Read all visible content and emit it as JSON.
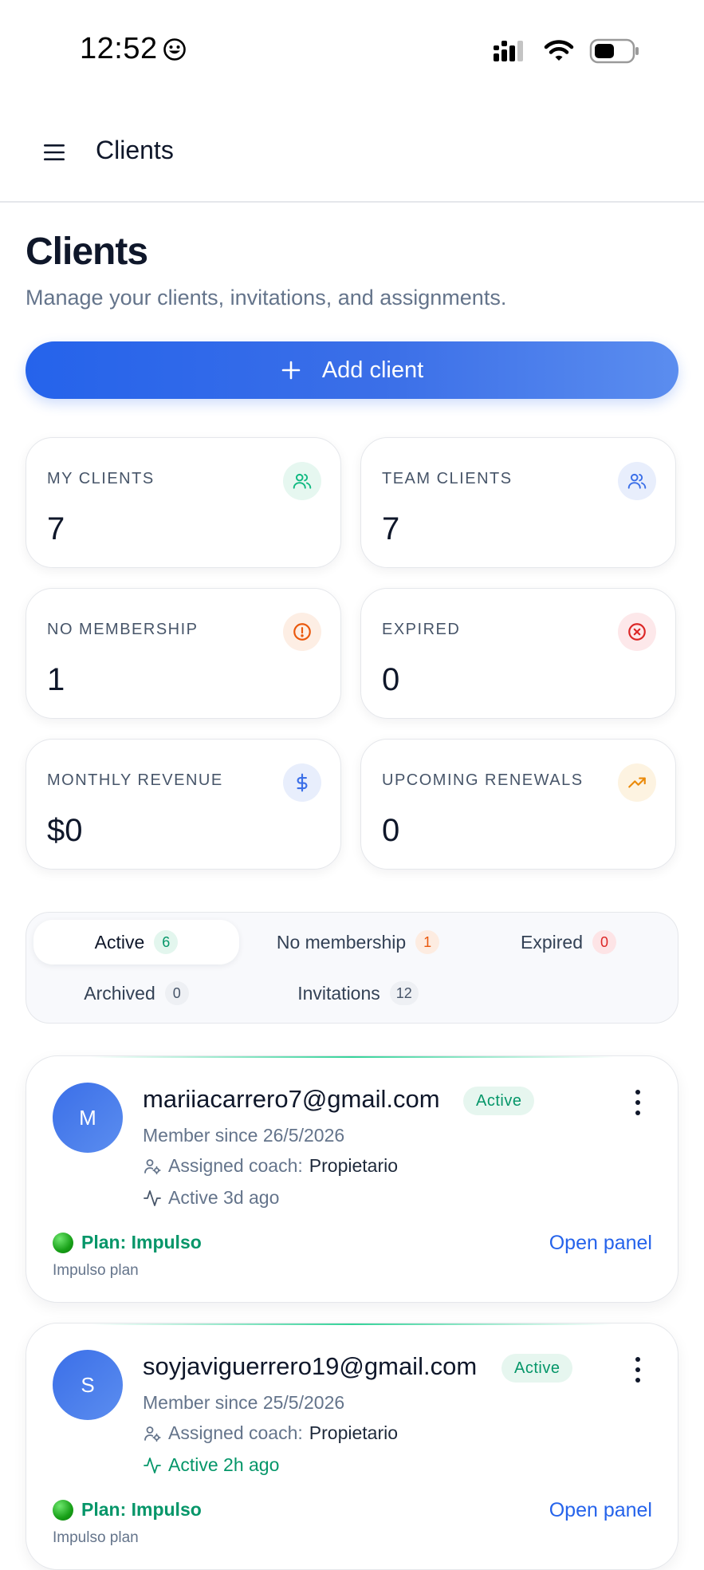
{
  "status_bar": {
    "time": "12:52"
  },
  "topbar": {
    "title": "Clients"
  },
  "page": {
    "title": "Clients",
    "subtitle": "Manage your clients, invitations, and assignments.",
    "add_button": "Add client"
  },
  "stats": [
    {
      "label": "MY CLIENTS",
      "value": "7",
      "icon": "users-icon",
      "color": "#10b981"
    },
    {
      "label": "TEAM CLIENTS",
      "value": "7",
      "icon": "users-icon",
      "color": "#3b6fe8"
    },
    {
      "label": "NO MEMBERSHIP",
      "value": "1",
      "icon": "alert-circle-icon",
      "color": "#ea580c"
    },
    {
      "label": "EXPIRED",
      "value": "0",
      "icon": "x-circle-icon",
      "color": "#dc2626"
    },
    {
      "label": "MONTHLY REVENUE",
      "value": "$0",
      "icon": "dollar-icon",
      "color": "#3b6fe8"
    },
    {
      "label": "UPCOMING RENEWALS",
      "value": "0",
      "icon": "trending-up-icon",
      "color": "#f59e0b"
    }
  ],
  "tabs": [
    {
      "label": "Active",
      "count": "6"
    },
    {
      "label": "No membership",
      "count": "1"
    },
    {
      "label": "Expired",
      "count": "0"
    },
    {
      "label": "Archived",
      "count": "0"
    },
    {
      "label": "Invitations",
      "count": "12"
    }
  ],
  "clients": [
    {
      "initial": "M",
      "email": "mariiacarrero7@gmail.com",
      "status": "Active",
      "member_since": "Member since 26/5/2026",
      "coach_label": "Assigned coach:",
      "coach_name": "Propietario",
      "activity": "Active 3d ago",
      "plan": "Plan: Impulso",
      "plan_sub": "Impulso plan",
      "open_panel": "Open panel"
    },
    {
      "initial": "S",
      "email": "soyjaviguerrero19@gmail.com",
      "status": "Active",
      "member_since": "Member since 25/5/2026",
      "coach_label": "Assigned coach:",
      "coach_name": "Propietario",
      "activity": "Active 2h ago",
      "plan": "Plan: Impulso",
      "plan_sub": "Impulso plan",
      "open_panel": "Open panel"
    }
  ],
  "colors": {
    "accent": "#2563eb",
    "success": "#059669",
    "muted": "#64748b"
  }
}
